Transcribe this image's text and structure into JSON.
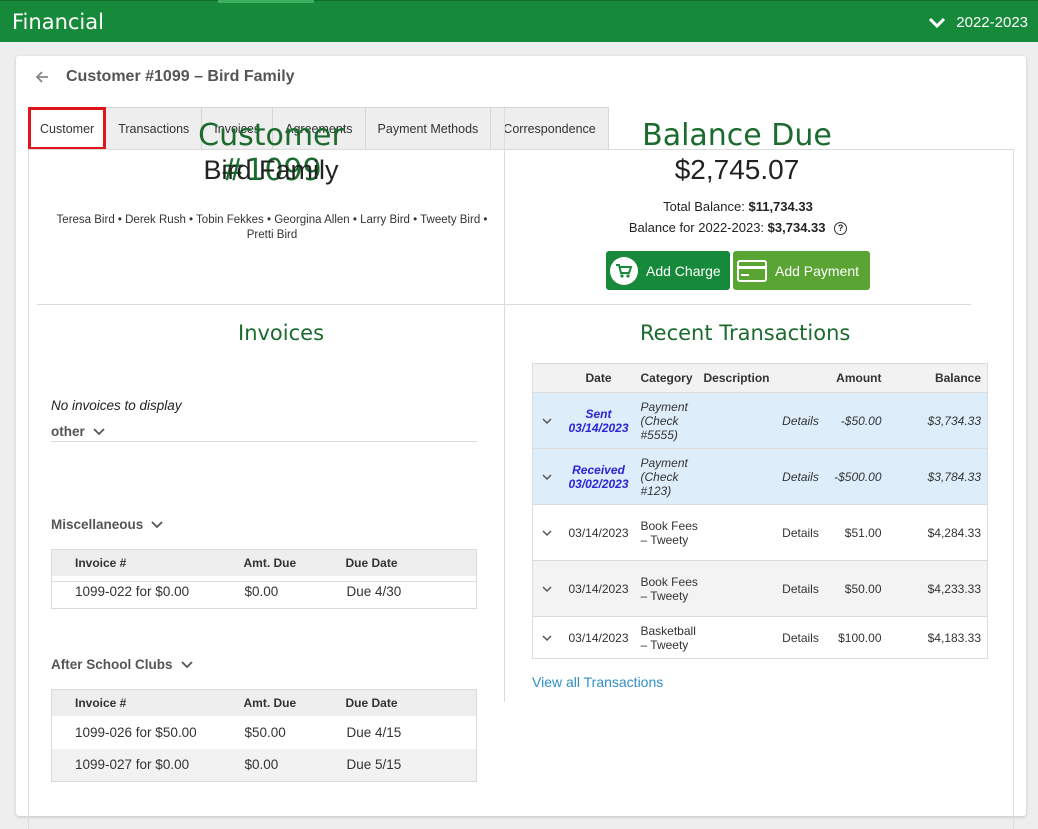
{
  "app": {
    "title": "Financial",
    "year": "2022-2023"
  },
  "header": {
    "title": "Customer #1099 – Bird Family"
  },
  "tabs": [
    "Customer",
    "Transactions",
    "Invoices",
    "Agreements",
    "Payment Methods",
    "Correspondence"
  ],
  "customer": {
    "number": "Customer #1099",
    "name": "Bird Family",
    "members": "Teresa Bird • Derek Rush • Tobin Fekkes • Georgina Allen • Larry Bird • Tweety Bird • Pretti Bird"
  },
  "balance": {
    "title": "Balance Due",
    "amount": "$2,745.07",
    "total_label": "Total Balance:",
    "total_value": "$11,734.33",
    "year_label": "Balance for 2022-2023:",
    "year_value": "$3,734.33",
    "add_charge": "Add Charge",
    "add_payment": "Add Payment"
  },
  "invoices": {
    "title": "Invoices",
    "headers": [
      "Invoice #",
      "Amt. Due",
      "Due Date"
    ],
    "groups": [
      {
        "label": "other",
        "empty": "No invoices to display",
        "rows": []
      },
      {
        "label": "Miscellaneous",
        "rows": [
          [
            "1099-022 for $0.00",
            "$0.00",
            "Due 4/30"
          ]
        ]
      },
      {
        "label": "After School Clubs",
        "rows": [
          [
            "1099-026 for $50.00",
            "$50.00",
            "Due 4/15"
          ],
          [
            "1099-027 for $0.00",
            "$0.00",
            "Due 5/15"
          ]
        ]
      }
    ]
  },
  "transactions": {
    "title": "Recent Transactions",
    "headers": [
      "Date",
      "Category",
      "Description",
      "Amount",
      "Balance"
    ],
    "details_label": "Details",
    "rows": [
      {
        "status": "Sent",
        "date": "03/14/2023",
        "category": "Payment (Check #5555)",
        "amount": "-$50.00",
        "balance": "$3,734.33"
      },
      {
        "status": "Received",
        "date": "03/02/2023",
        "category": "Payment (Check #123)",
        "amount": "-$500.00",
        "balance": "$3,784.33"
      },
      {
        "date": "03/14/2023",
        "category": "Book Fees – Tweety",
        "amount": "$51.00",
        "balance": "$4,284.33"
      },
      {
        "date": "03/14/2023",
        "category": "Book Fees – Tweety",
        "amount": "$50.00",
        "balance": "$4,233.33"
      },
      {
        "date": "03/14/2023",
        "category": "Basketball – Tweety",
        "amount": "$100.00",
        "balance": "$4,183.33"
      }
    ],
    "view_all": "View all Transactions"
  },
  "colors": {
    "brand_green": "#168a3a",
    "payment_green": "#5aa433",
    "heading_green": "#1b6b2e",
    "link_blue": "#2f8fc3",
    "active_tab_outline": "#e0151b",
    "pending_row": "#ddeefa",
    "pending_text": "#2b23d6"
  },
  "icons": [
    "chevron-down-icon",
    "back-arrow-icon",
    "help-circle-icon",
    "cart-icon",
    "credit-card-icon"
  ]
}
